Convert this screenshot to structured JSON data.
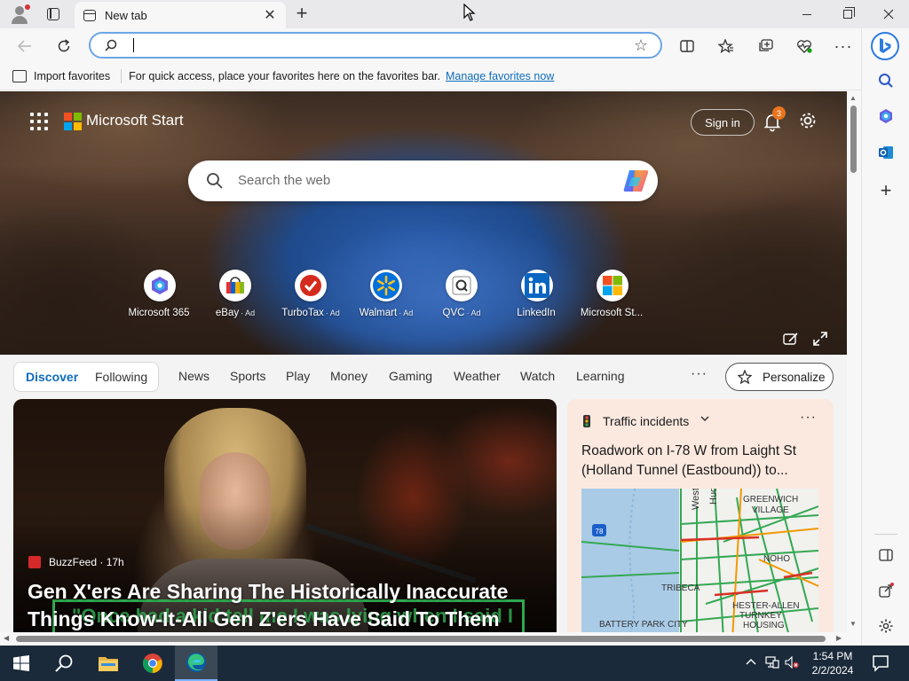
{
  "browser": {
    "tab_title": "New tab",
    "tab_close": "✕",
    "new_tab": "+",
    "omnibox_value": "",
    "favorites_bar": {
      "import_label": "Import favorites",
      "message": "For quick access, place your favorites here on the favorites bar.",
      "link": "Manage favorites now"
    }
  },
  "page": {
    "brand": "Microsoft Start",
    "sign_in": "Sign in",
    "notification_count": "3",
    "search_placeholder": "Search the web",
    "quick_links": [
      {
        "label": "Microsoft 365",
        "ad": ""
      },
      {
        "label": "eBay",
        "ad": "· Ad"
      },
      {
        "label": "TurboTax",
        "ad": "· Ad"
      },
      {
        "label": "Walmart",
        "ad": "· Ad"
      },
      {
        "label": "QVC",
        "ad": "· Ad"
      },
      {
        "label": "LinkedIn",
        "ad": ""
      },
      {
        "label": "Microsoft St...",
        "ad": ""
      }
    ],
    "feed_tabs": {
      "discover": "Discover",
      "following": "Following",
      "links": [
        "News",
        "Sports",
        "Play",
        "Money",
        "Gaming",
        "Weather",
        "Watch",
        "Learning"
      ],
      "more": "···",
      "personalize": "Personalize"
    },
    "main_story": {
      "source": "BuzzFeed · 17h",
      "headline": "Gen X'ers Are Sharing The Historically Inaccurate Things Know-It-All Gen Z'ers Have Said To Them",
      "image_text": "\"Once had a kid tell me I was lying when I said I"
    },
    "traffic": {
      "title": "Traffic incidents",
      "more": "···",
      "headline": "Roadwork on I-78 W from Laight St (Holland Tunnel (Eastbound)) to...",
      "map_labels": {
        "west": "West",
        "huds": "Huds",
        "greenwich": "GREENWICH",
        "village": "VILLAGE",
        "noho": "NOHO",
        "tribeca": "TRIBECA",
        "hester1": "HESTER-ALLEN",
        "hester2": "TURNKEY",
        "hester3": "HOUSING",
        "battery": "BATTERY PARK CITY",
        "shield": "78"
      }
    }
  },
  "taskbar": {
    "time": "1:54 PM",
    "date": "2/2/2024"
  },
  "colors": {
    "accent": "#0f6cbd",
    "omnibox_border": "#6aa6e6",
    "traffic_card_bg": "#fbe9df",
    "taskbar_bg": "#1b2a3a"
  }
}
